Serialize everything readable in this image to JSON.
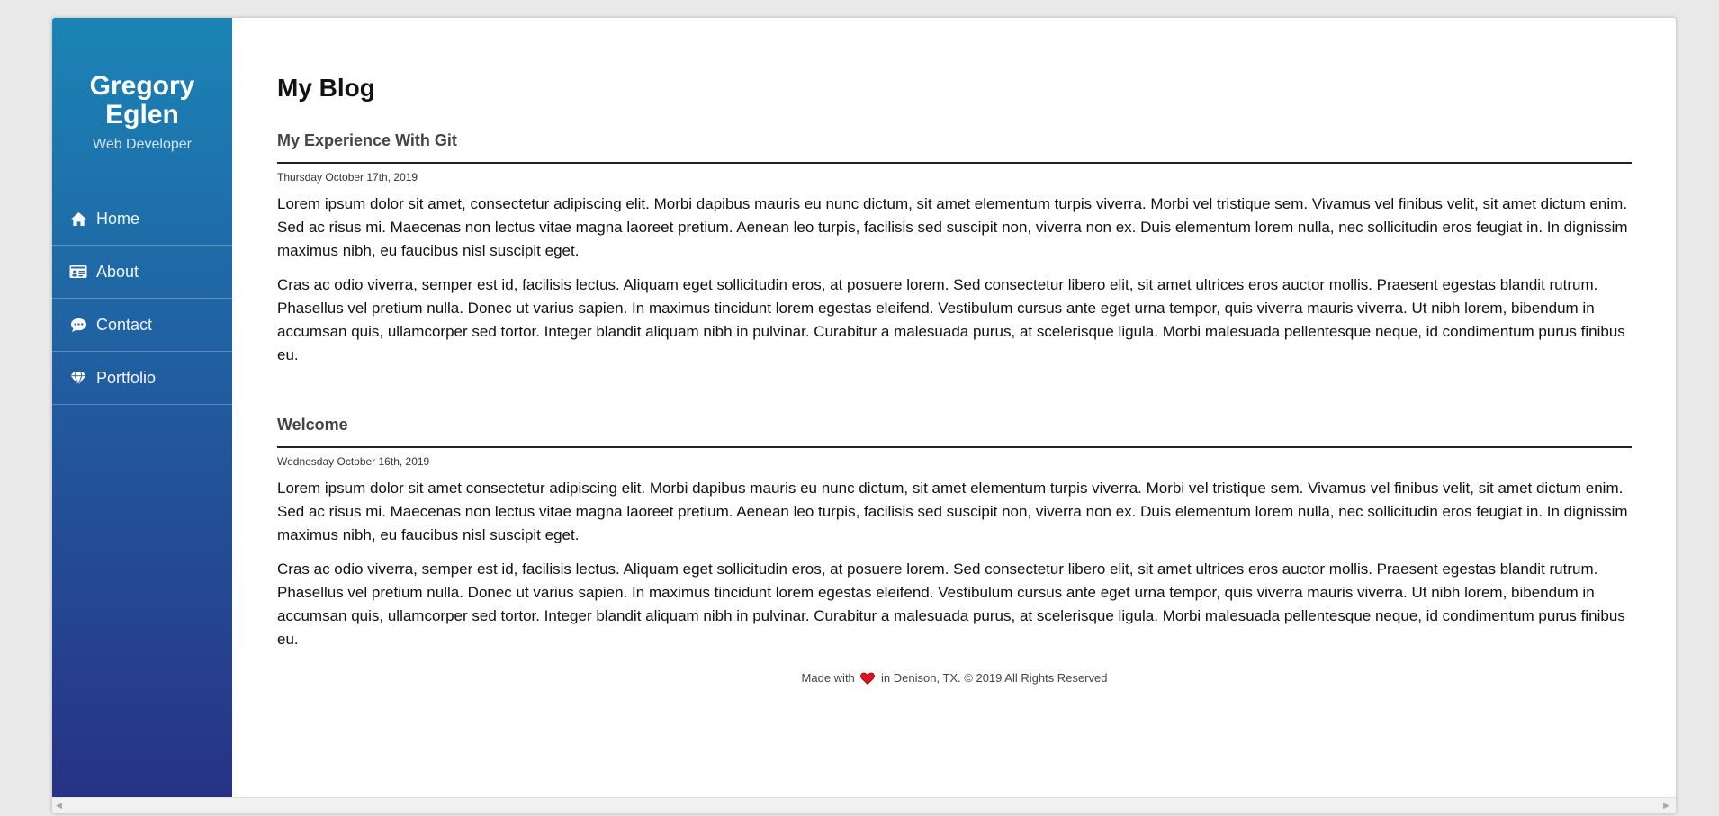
{
  "profile": {
    "name": "Gregory Eglen",
    "title": "Web Developer"
  },
  "nav": {
    "items": [
      {
        "label": "Home",
        "icon": "home-icon"
      },
      {
        "label": "About",
        "icon": "id-card-icon"
      },
      {
        "label": "Contact",
        "icon": "chat-bubble-icon"
      },
      {
        "label": "Portfolio",
        "icon": "diamond-icon"
      }
    ]
  },
  "main": {
    "title": "My Blog",
    "posts": [
      {
        "title": "My Experience With Git",
        "date": "Thursday October 17th, 2019",
        "paragraphs": [
          "Lorem ipsum dolor sit amet, consectetur adipiscing elit. Morbi dapibus mauris eu nunc dictum, sit amet elementum turpis viverra. Morbi vel tristique sem. Vivamus vel finibus velit, sit amet dictum enim. Sed ac risus mi. Maecenas non lectus vitae magna laoreet pretium. Aenean leo turpis, facilisis sed suscipit non, viverra non ex. Duis elementum lorem nulla, nec sollicitudin eros feugiat in. In dignissim maximus nibh, eu faucibus nisl suscipit eget.",
          "Cras ac odio viverra, semper est id, facilisis lectus. Aliquam eget sollicitudin eros, at posuere lorem. Sed consectetur libero elit, sit amet ultrices eros auctor mollis. Praesent egestas blandit rutrum. Phasellus vel pretium nulla. Donec ut varius sapien. In maximus tincidunt lorem egestas eleifend. Vestibulum cursus ante eget urna tempor, quis viverra mauris viverra. Ut nibh lorem, bibendum in accumsan quis, ullamcorper sed tortor. Integer blandit aliquam nibh in pulvinar. Curabitur a malesuada purus, at scelerisque ligula. Morbi malesuada pellentesque neque, id condimentum purus finibus eu."
        ]
      },
      {
        "title": "Welcome",
        "date": "Wednesday October 16th, 2019",
        "paragraphs": [
          "Lorem ipsum dolor sit amet consectetur adipiscing elit. Morbi dapibus mauris eu nunc dictum, sit amet elementum turpis viverra. Morbi vel tristique sem. Vivamus vel finibus velit, sit amet dictum enim. Sed ac risus mi. Maecenas non lectus vitae magna laoreet pretium. Aenean leo turpis, facilisis sed suscipit non, viverra non ex. Duis elementum lorem nulla, nec sollicitudin eros feugiat in. In dignissim maximus nibh, eu faucibus nisl suscipit eget.",
          "Cras ac odio viverra, semper est id, facilisis lectus. Aliquam eget sollicitudin eros, at posuere lorem. Sed consectetur libero elit, sit amet ultrices eros auctor mollis. Praesent egestas blandit rutrum. Phasellus vel pretium nulla. Donec ut varius sapien. In maximus tincidunt lorem egestas eleifend. Vestibulum cursus ante eget urna tempor, quis viverra mauris viverra. Ut nibh lorem, bibendum in accumsan quis, ullamcorper sed tortor. Integer blandit aliquam nibh in pulvinar. Curabitur a malesuada purus, at scelerisque ligula. Morbi malesuada pellentesque neque, id condimentum purus finibus eu."
        ]
      }
    ]
  },
  "footer": {
    "before": "Made with",
    "after": "in Denison, TX. © 2019 All Rights Reserved",
    "icon": "heart-icon"
  },
  "colors": {
    "sidebar_top": "#1b84b5",
    "sidebar_bottom": "#283285",
    "heart": "#e0121d"
  }
}
